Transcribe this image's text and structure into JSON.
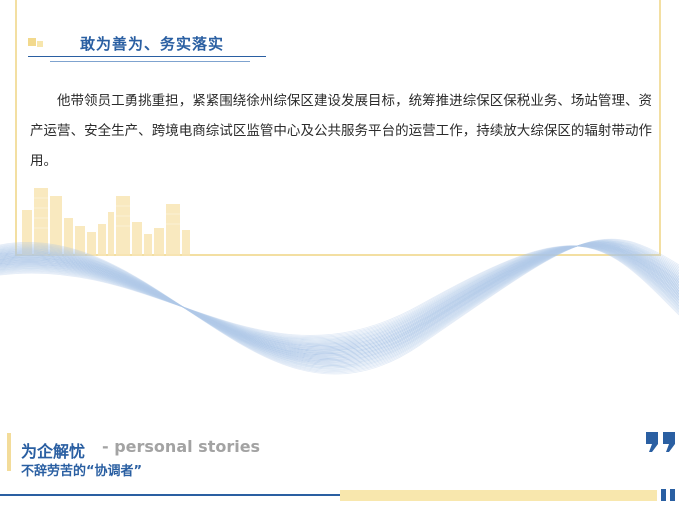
{
  "section": {
    "heading": "敢为善为、务实落实",
    "body": "他带领员工勇挑重担，紧紧围绕徐州综保区建设发展目标，统筹推进综保区保税业务、场站管理、资产运营、安全生产、跨境电商综试区监管中心及公共服务平台的运营工作，持续放大综保区的辐射带动作用。"
  },
  "footer": {
    "title": "为企解忧",
    "subtitle_en": "- personal stories",
    "tagline": "不辞劳苦的“协调者”"
  },
  "colors": {
    "accent_blue": "#2a5fa2",
    "accent_yellow": "#f3dc9a"
  },
  "icons": [
    "city-skyline-decoration",
    "blue-wave-decoration",
    "quote-icon"
  ]
}
